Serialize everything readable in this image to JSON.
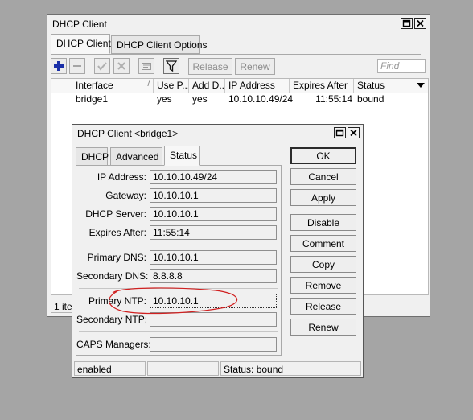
{
  "main_window": {
    "title": "DHCP Client",
    "tabs": [
      "DHCP Client",
      "DHCP Client Options"
    ],
    "toolbar": {
      "release_label": "Release",
      "renew_label": "Renew",
      "find_placeholder": "Find"
    },
    "columns": [
      "Interface",
      "Use P...",
      "Add D...",
      "IP Address",
      "Expires After",
      "Status"
    ],
    "rows": [
      {
        "interface": "bridge1",
        "use_peer": "yes",
        "add_default": "yes",
        "ip_address": "10.10.10.49/24",
        "expires_after": "11:55:14",
        "status": "bound"
      }
    ],
    "item_count": "1 item"
  },
  "dialog": {
    "title": "DHCP Client <bridge1>",
    "tabs": [
      "DHCP",
      "Advanced",
      "Status"
    ],
    "active_tab": "Status",
    "fields": {
      "ip_address": {
        "label": "IP Address:",
        "value": "10.10.10.49/24"
      },
      "gateway": {
        "label": "Gateway:",
        "value": "10.10.10.1"
      },
      "dhcp_server": {
        "label": "DHCP Server:",
        "value": "10.10.10.1"
      },
      "expires_after": {
        "label": "Expires After:",
        "value": "11:55:14"
      },
      "primary_dns": {
        "label": "Primary DNS:",
        "value": "10.10.10.1"
      },
      "secondary_dns": {
        "label": "Secondary DNS:",
        "value": "8.8.8.8"
      },
      "primary_ntp": {
        "label": "Primary NTP:",
        "value": "10.10.10.1"
      },
      "secondary_ntp": {
        "label": "Secondary NTP:",
        "value": ""
      },
      "caps_managers": {
        "label": "CAPS Managers:",
        "value": ""
      }
    },
    "buttons": [
      "OK",
      "Cancel",
      "Apply",
      "Disable",
      "Comment",
      "Copy",
      "Remove",
      "Release",
      "Renew"
    ],
    "statusbar": {
      "left": "enabled",
      "middle": "",
      "right": "Status: bound"
    }
  },
  "colors": {
    "desktop": "#a5a5a5",
    "window_bg": "#f0f0f0",
    "add_icon": "#1a2fa8",
    "annotation": "#d02020"
  },
  "icons": [
    "add-icon",
    "remove-icon",
    "check-icon",
    "cross-icon",
    "comment-icon",
    "filter-icon",
    "maximize-icon",
    "close-icon",
    "sort-arrow-icon",
    "column-menu-icon"
  ]
}
